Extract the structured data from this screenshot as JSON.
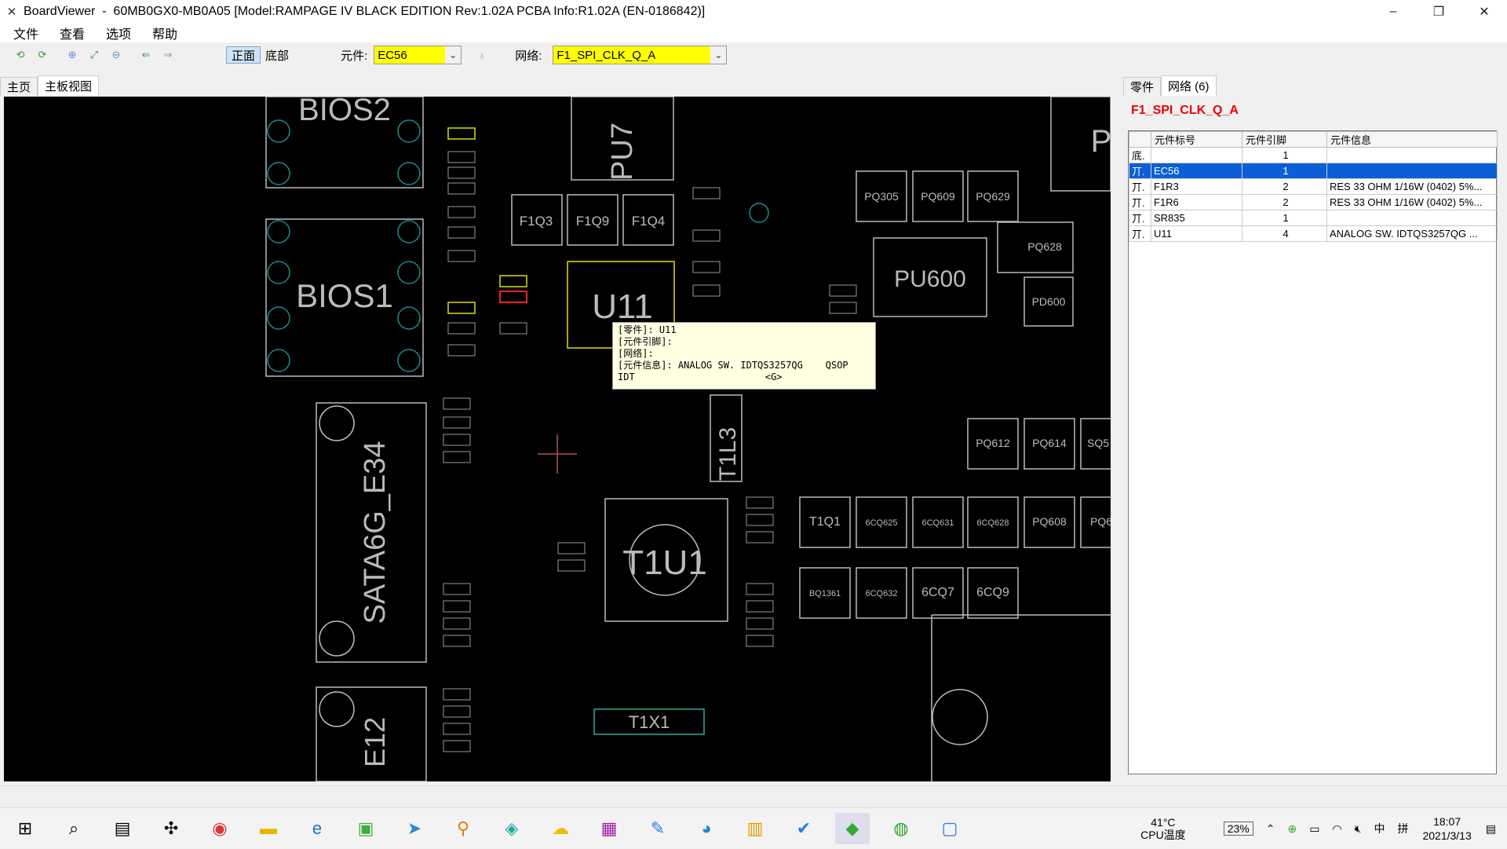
{
  "window": {
    "app_name": "BoardViewer",
    "title": "60MB0GX0-MB0A05 [Model:RAMPAGE IV BLACK EDITION Rev:1.02A PCBA Info:R1.02A (EN-0186842)]",
    "minimize": "–",
    "restore": "❐",
    "close": "✕"
  },
  "menu": [
    "文件",
    "查看",
    "选项",
    "帮助"
  ],
  "toolbar": {
    "side_top": "正面",
    "side_bottom": "底部",
    "part_label": "元件:",
    "part_value": "EC56",
    "net_label": "网络:",
    "net_value": "F1_SPI_CLK_Q_A"
  },
  "left_tabs": [
    "主页",
    "主板视图"
  ],
  "right_tabs": {
    "parts": "零件",
    "nets": "网络 (6)"
  },
  "net_name": "F1_SPI_CLK_Q_A",
  "table": {
    "headers": [
      "元件标号",
      "元件引脚",
      "元件信息"
    ],
    "rows": [
      {
        "side": "底.",
        "ref": "",
        "pin": "1",
        "info": ""
      },
      {
        "side": "丌.",
        "ref": "EC56",
        "pin": "1",
        "info": ""
      },
      {
        "side": "丌.",
        "ref": "F1R3",
        "pin": "2",
        "info": "RES 33 OHM 1/16W (0402) 5%..."
      },
      {
        "side": "丌.",
        "ref": "F1R6",
        "pin": "2",
        "info": "RES 33 OHM 1/16W (0402) 5%..."
      },
      {
        "side": "丌.",
        "ref": "SR835",
        "pin": "1",
        "info": ""
      },
      {
        "side": "丌.",
        "ref": "U11",
        "pin": "4",
        "info": "ANALOG SW. IDTQS3257QG ..."
      }
    ]
  },
  "tooltip": {
    "line1": "[零件]: U11",
    "line2": "[元件引脚]:",
    "line3": "[网络]:",
    "line4": "[元件信息]: ANALOG SW. IDTQS3257QG    QSOP",
    "line5": "IDT                       <G>"
  },
  "board_labels": [
    "BIOS2",
    "BIOS1",
    "SATA6G_E34",
    "E12",
    "PU7",
    "F1Q3",
    "F1Q9",
    "F1Q4",
    "U11",
    "PU600",
    "PQ305",
    "PQ609",
    "PQ629",
    "PQ628",
    "PD600",
    "T1U1",
    "T1L3",
    "T1X1",
    "PQ612",
    "PQ614",
    "SQ5",
    "T1Q1",
    "6CQ625",
    "6CQ631",
    "6CQ628",
    "PQ608",
    "PQ6",
    "BQ1361",
    "6CQ632",
    "6CQ7",
    "6CQ9",
    "P"
  ],
  "taskbar": {
    "temp": "41°C",
    "temp_label": "CPU温度",
    "battery": "23%",
    "ime": "中",
    "ime2": "拼",
    "time": "18:07",
    "date": "2021/3/13"
  }
}
